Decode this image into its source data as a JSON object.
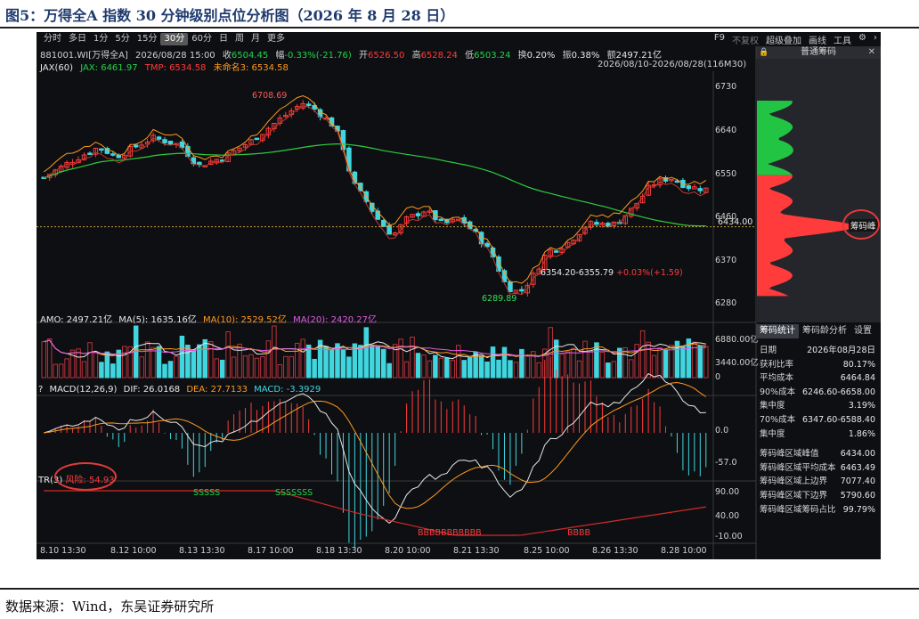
{
  "figure_title": "图5：万得全A 指数 30 分钟级别点位分析图（2026 年 8 月 28 日）",
  "source_note": "数据来源：Wind，东吴证券研究所",
  "toolbar": {
    "periods": [
      "分时",
      "多日",
      "1分",
      "5分",
      "15分",
      "30分",
      "60分",
      "日",
      "周",
      "月",
      "更多"
    ],
    "active_period": "30分",
    "right_items": [
      "F9",
      "不复权",
      "超级叠加",
      "画线",
      "工具"
    ],
    "settings_icon": "gear-icon",
    "more_icon": "chevron-right-icon"
  },
  "quote": {
    "code": "881001.WI[万得全A]",
    "time": "2026/08/28 15:00",
    "close_label": "收",
    "close": "6504.45",
    "change_label": "幅",
    "change": "-0.33%(-21.76)",
    "open_label": "开",
    "open": "6526.50",
    "high_label": "高",
    "high": "6528.24",
    "low_label": "低",
    "low": "6503.24",
    "turnover_label": "换",
    "turnover": "0.20%",
    "amplitude_label": "振",
    "amplitude": "0.38%",
    "amount_label": "额",
    "amount": "2497.21亿"
  },
  "jax": {
    "name": "JAX(60)",
    "jax": "JAX: 6461.97",
    "tmp": "TMP: 6534.58",
    "unnamed": "未命名3: 6534.58"
  },
  "date_range": "2026/08/10-2026/08/28(116M30)",
  "chip_panel": {
    "title": "普通筹码",
    "lock_icon": "lock-icon",
    "close_icon": "close-icon",
    "peak_label": "筹码峰",
    "price_tag": "6434.00"
  },
  "price_axis": [
    "6730",
    "6640",
    "6550",
    "6460",
    "6370",
    "6280"
  ],
  "annotations": {
    "high_point": "6708.69",
    "low_point": "6289.89",
    "range_label": "6354.20-6355.79",
    "range_change": "+0.03%(+1.59)"
  },
  "amo": {
    "amo": "AMO: 2497.21亿",
    "ma5": "MA(5): 1635.16亿",
    "ma10": "MA(10): 2529.52亿",
    "ma20": "MA(20): 2420.27亿",
    "axis": [
      "6880.00亿",
      "3440.00亿",
      "0"
    ]
  },
  "macd": {
    "name": "MACD(12,26,9)",
    "dif": "DIF: 26.0168",
    "dea": "DEA: 27.7133",
    "macd": "MACD: -3.3929",
    "axis": [
      "0.0",
      "-57.0"
    ]
  },
  "tr": {
    "name": "TR(3)",
    "risk": "风险: 54.93",
    "axis": [
      "90.00",
      "40.00",
      "-10.00"
    ],
    "s_marks": [
      "SSSSS",
      "SSSSSSS"
    ],
    "b_marks": [
      "BBBBBBBBBBB",
      "BBBB"
    ]
  },
  "x_axis": [
    "8.10 13:30",
    "8.12 10:00",
    "8.13 13:30",
    "8.17 10:00",
    "8.18 13:30",
    "8.20 10:00",
    "8.21 13:30",
    "8.25 10:00",
    "8.26 13:30",
    "8.28 10:00"
  ],
  "chip_tabs": [
    "筹码统计",
    "筹码龄分析",
    "设置"
  ],
  "chip_stats": [
    {
      "label": "日期",
      "value": "2026年08月28日"
    },
    {
      "label": "获利比率",
      "value": "80.17%"
    },
    {
      "label": "平均成本",
      "value": "6464.84"
    },
    {
      "label": "90%成本",
      "value": "6246.60-6658.00"
    },
    {
      "label": "集中度",
      "value": "3.19%"
    },
    {
      "label": "70%成本",
      "value": "6347.60-6588.40"
    },
    {
      "label": "集中度",
      "value": "1.86%"
    }
  ],
  "chip_stats2": [
    {
      "label": "筹码峰区域峰值",
      "value": "6434.00"
    },
    {
      "label": "筹码峰区域平均成本",
      "value": "6463.49"
    },
    {
      "label": "筹码峰区域上边界",
      "value": "7077.40"
    },
    {
      "label": "筹码峰区域下边界",
      "value": "5790.60"
    },
    {
      "label": "筹码峰区域筹码占比",
      "value": "99.79%"
    }
  ],
  "colors": {
    "up": "#ff3b3b",
    "down": "#40d6e0",
    "ma_long": "#2ecc40",
    "jax": "#ff9a1f",
    "background": "#0e0f12"
  }
}
